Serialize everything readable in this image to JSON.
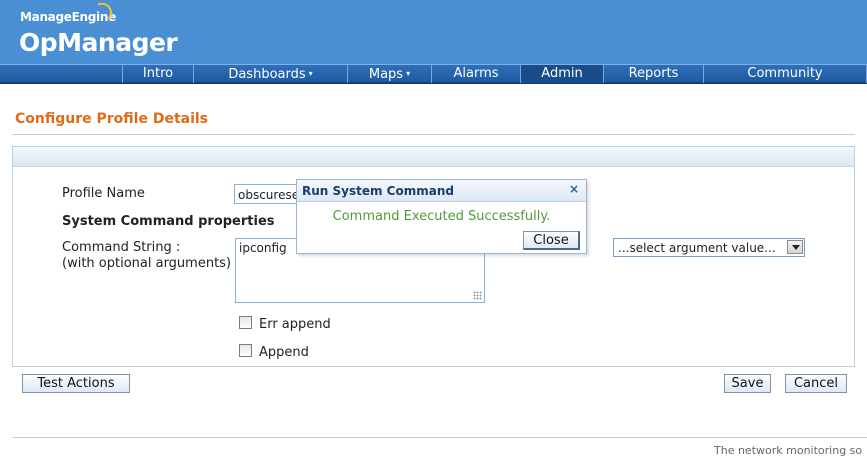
{
  "brand": {
    "company": "ManageEngine",
    "product": "OpManager"
  },
  "nav": {
    "items": [
      {
        "label": "Intro",
        "has_menu": false
      },
      {
        "label": "Dashboards",
        "has_menu": true
      },
      {
        "label": "Maps",
        "has_menu": true
      },
      {
        "label": "Alarms",
        "has_menu": false
      },
      {
        "label": "Admin",
        "has_menu": false,
        "active": true
      },
      {
        "label": "Reports",
        "has_menu": false
      },
      {
        "label": "Community",
        "has_menu": false
      }
    ],
    "caret_icon": "▾"
  },
  "page": {
    "title": "Configure Profile Details"
  },
  "form": {
    "profile_name_label": "Profile Name",
    "profile_name_value": "obscurese",
    "section_heading": "System Command properties",
    "command_label_line1": "Command String :",
    "command_label_line2": "(with optional arguments)",
    "command_value": "ipconfig",
    "argument_select_value": "...select argument value...",
    "err_append_label": "Err append",
    "err_append_checked": false,
    "append_label": "Append",
    "append_checked": false
  },
  "buttons": {
    "test_actions": "Test Actions",
    "save": "Save",
    "cancel": "Cancel"
  },
  "dialog": {
    "title": "Run System Command",
    "close_icon": "×",
    "message": "Command Executed Successfully.",
    "close_button": "Close"
  },
  "footer": {
    "text": "The network monitoring so"
  },
  "colors": {
    "header_bg": "#4a8fd4",
    "nav_bg": "#1d5aa2",
    "title_orange": "#e06a1a",
    "success_green": "#4e9b3c"
  }
}
